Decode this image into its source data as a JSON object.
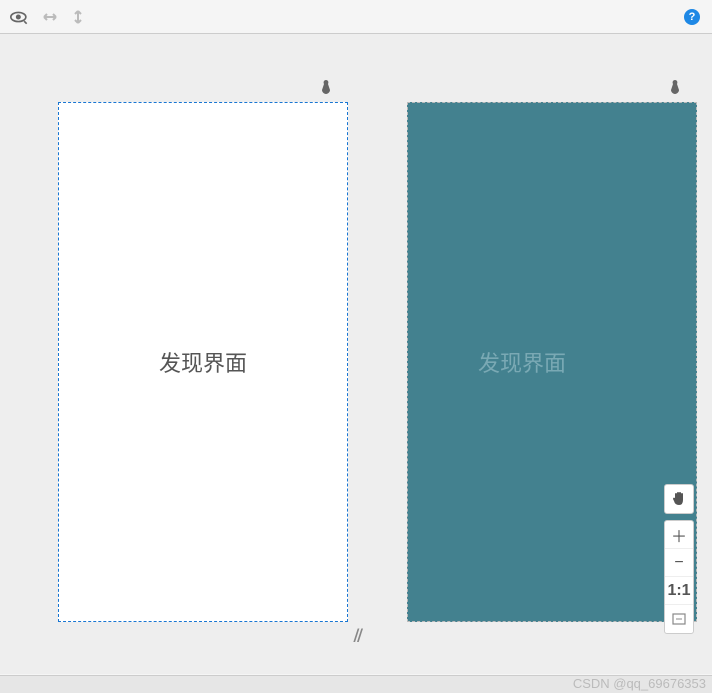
{
  "toolbar": {
    "help_label": "?"
  },
  "panels": {
    "left": {
      "label": "发现界面"
    },
    "right": {
      "label": "发现界面"
    }
  },
  "zoom": {
    "pan_icon": "hand",
    "plus": "＋",
    "minus": "−",
    "oneToOne": "1:1",
    "fit_icon": "fit"
  },
  "resize_handle": "//",
  "watermark": "CSDN @qq_69676353"
}
